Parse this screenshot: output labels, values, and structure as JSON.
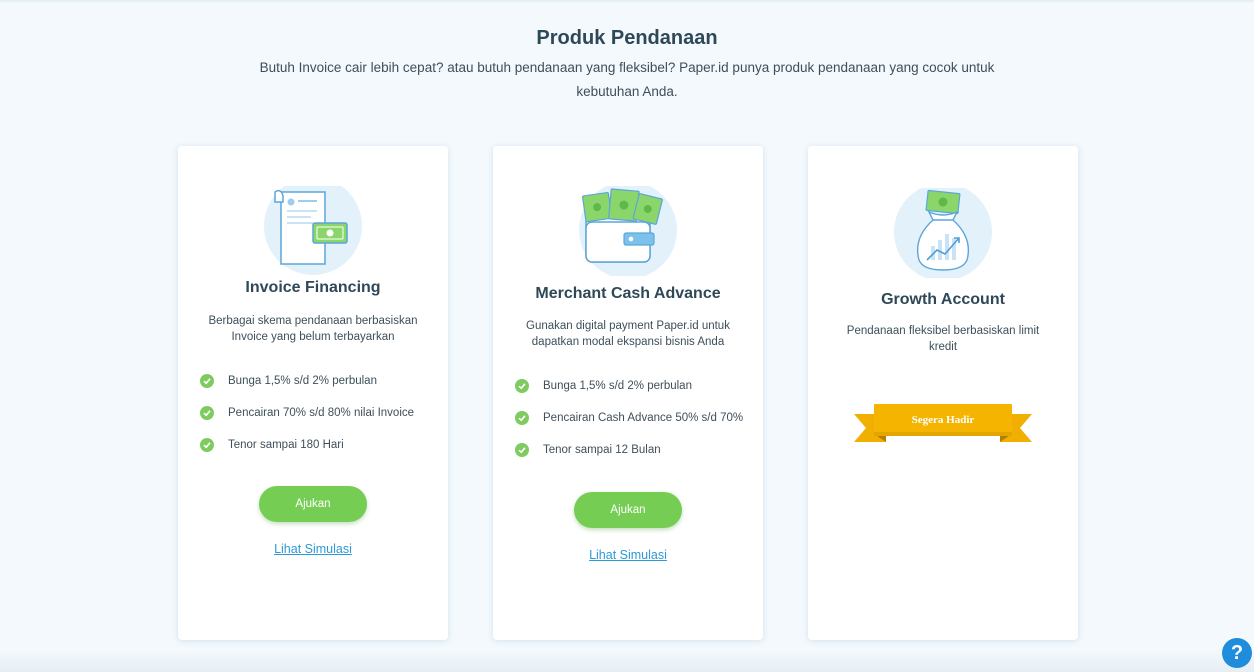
{
  "header": {
    "title": "Produk Pendanaan",
    "subtitle": "Butuh Invoice cair lebih cepat? atau butuh pendanaan yang fleksibel? Paper.id punya produk pendanaan yang cocok untuk kebutuhan Anda."
  },
  "cards": [
    {
      "title": "Invoice Financing",
      "icon": "invoice-document-icon",
      "description": "Berbagai skema pendanaan berbasiskan Invoice yang belum terbayarkan",
      "features": [
        "Bunga 1,5% s/d 2% perbulan",
        "Pencairan 70% s/d 80% nilai Invoice",
        "Tenor sampai 180 Hari"
      ],
      "button": "Ajukan",
      "link": "Lihat Simulasi"
    },
    {
      "title": "Merchant Cash Advance",
      "icon": "wallet-cash-icon",
      "description": "Gunakan digital payment Paper.id untuk dapatkan modal ekspansi bisnis Anda",
      "features": [
        "Bunga 1,5% s/d 2% perbulan",
        "Pencairan Cash Advance 50% s/d 70%",
        "Tenor sampai 12 Bulan"
      ],
      "button": "Ajukan",
      "link": "Lihat Simulasi"
    },
    {
      "title": "Growth Account",
      "icon": "money-bag-growth-icon",
      "description": "Pendanaan fleksibel berbasiskan limit kredit",
      "badge": "Segera Hadir"
    }
  ],
  "help": {
    "label": "?"
  },
  "colors": {
    "accent_green": "#76cd54",
    "check_green": "#7fcb61",
    "link_blue": "#2d9ad6",
    "ribbon_yellow": "#f4b400",
    "background": "#f3f9fd"
  }
}
